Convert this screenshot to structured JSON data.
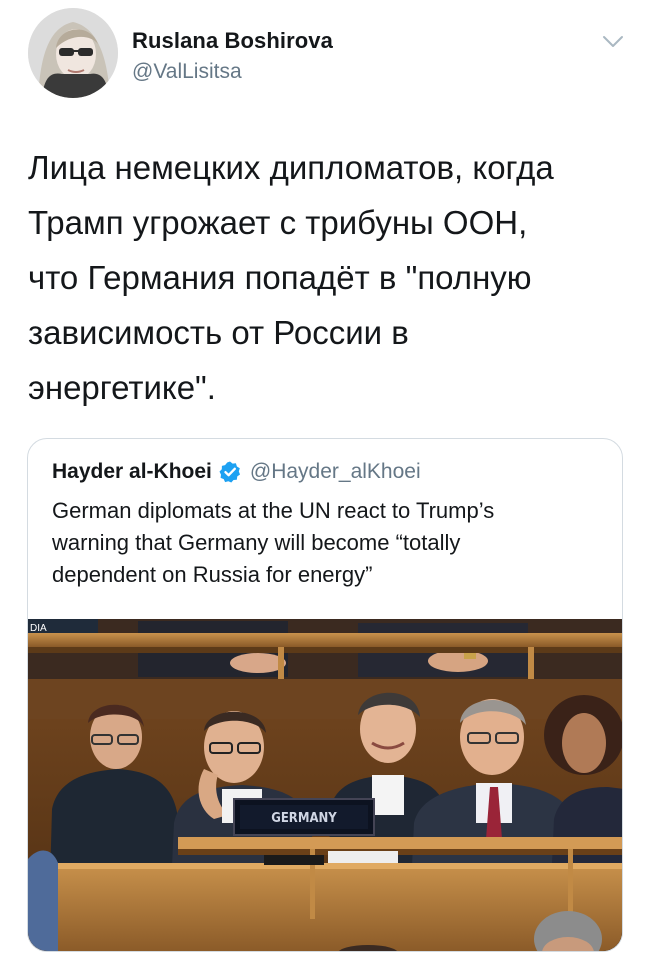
{
  "author": {
    "name": "Ruslana Boshirova",
    "handle": "@ValLisitsa"
  },
  "tweet": {
    "lines": [
      "Лица немецких дипломатов, когда",
      "Трамп угрожает с трибуны ООН,",
      "что Германия попадёт в \"полную",
      "зависимость от России в",
      "энергетике\"."
    ]
  },
  "quoted_tweet": {
    "name": "Hayder al-Khoei",
    "handle": "@Hayder_alKhoei",
    "verified_icon": "verified-badge-icon",
    "lines": [
      "German diplomats at the UN react to Trump’s",
      "warning that Germany will become “totally",
      "dependent on Russia for energy”"
    ],
    "photo": {
      "placard_label": "GERMANY",
      "corner_label": "DIA"
    }
  },
  "icons": {
    "menu": "chevron-down-icon"
  },
  "colors": {
    "text_primary": "#14171a",
    "text_secondary": "#657786",
    "verified_blue": "#1da1f2",
    "border": "#d4dbe1"
  }
}
